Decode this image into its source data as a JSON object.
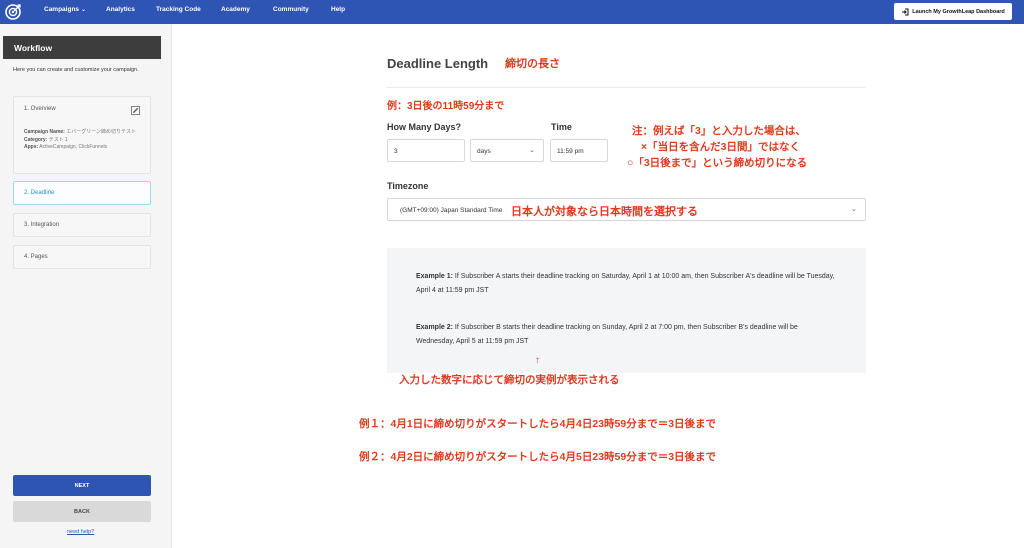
{
  "nav": {
    "items": [
      "Campaigns",
      "Analytics",
      "Tracking Code",
      "Academy",
      "Community",
      "Help"
    ],
    "caret": "⌄",
    "launch_label": "Launch My GrowthLeap Dashboard"
  },
  "sidebar": {
    "header": "Workflow",
    "description": "Here you can create and customize your campaign.",
    "steps": [
      {
        "label": "1. Overview"
      },
      {
        "label": "2. Deadline"
      },
      {
        "label": "3. Integration"
      },
      {
        "label": "4. Pages"
      }
    ],
    "campaign": {
      "name_label": "Campaign Name:",
      "name_value": "エバーグリーン締め切りテスト",
      "category_label": "Category:",
      "category_value": "テスト１",
      "apps_label": "Apps:",
      "apps_value": "ActiveCampaign, ClickFunnels"
    },
    "next_label": "NEXT",
    "back_label": "BACK",
    "help_label": "need help?"
  },
  "main": {
    "title": "Deadline Length",
    "days_label": "How Many Days?",
    "days_value": "3",
    "unit_value": "days",
    "time_label": "Time",
    "time_value": "11:59 pm",
    "timezone_label": "Timezone",
    "timezone_value": "(GMT+09:00) Japan Standard Time",
    "example1_label": "Example 1:",
    "example1_text": " If Subscriber A starts their deadline tracking on Saturday, April 1 at 10:00 am, then Subscriber A's deadline will be  Tuesday, April 4 at 11:59 pm JST",
    "example2_label": "Example 2:",
    "example2_text": " If Subscriber B starts their deadline tracking on  Sunday, April 2 at 7:00 pm, then Subscriber B's deadline will be  Wednesday, April 5 at 11:59 pm JST"
  },
  "annotations": {
    "title_jp": "締切の長さ",
    "example_jp": "例：3日後の11時59分まで",
    "note1": "注：例えば「3」と入力した場合は、",
    "note2": "×「当日を含んだ3日間」ではなく",
    "note3": "○「3日後まで」という締め切りになる",
    "timezone_jp": "日本人が対象なら日本時間を選択する",
    "arrow": "↑",
    "examples_jp": "入力した数字に応じて締切の実例が表示される",
    "ex1_jp": "例１：4月1日に締め切りがスタートしたら4月4日23時59分まで＝3日後まで",
    "ex2_jp": "例２：4月2日に締め切りがスタートしたら4月5日23時59分まで＝3日後まで"
  },
  "colors": {
    "brand": "#2f55b4",
    "annotation": "#e03a1e",
    "active_step": "#2a8fbd"
  }
}
